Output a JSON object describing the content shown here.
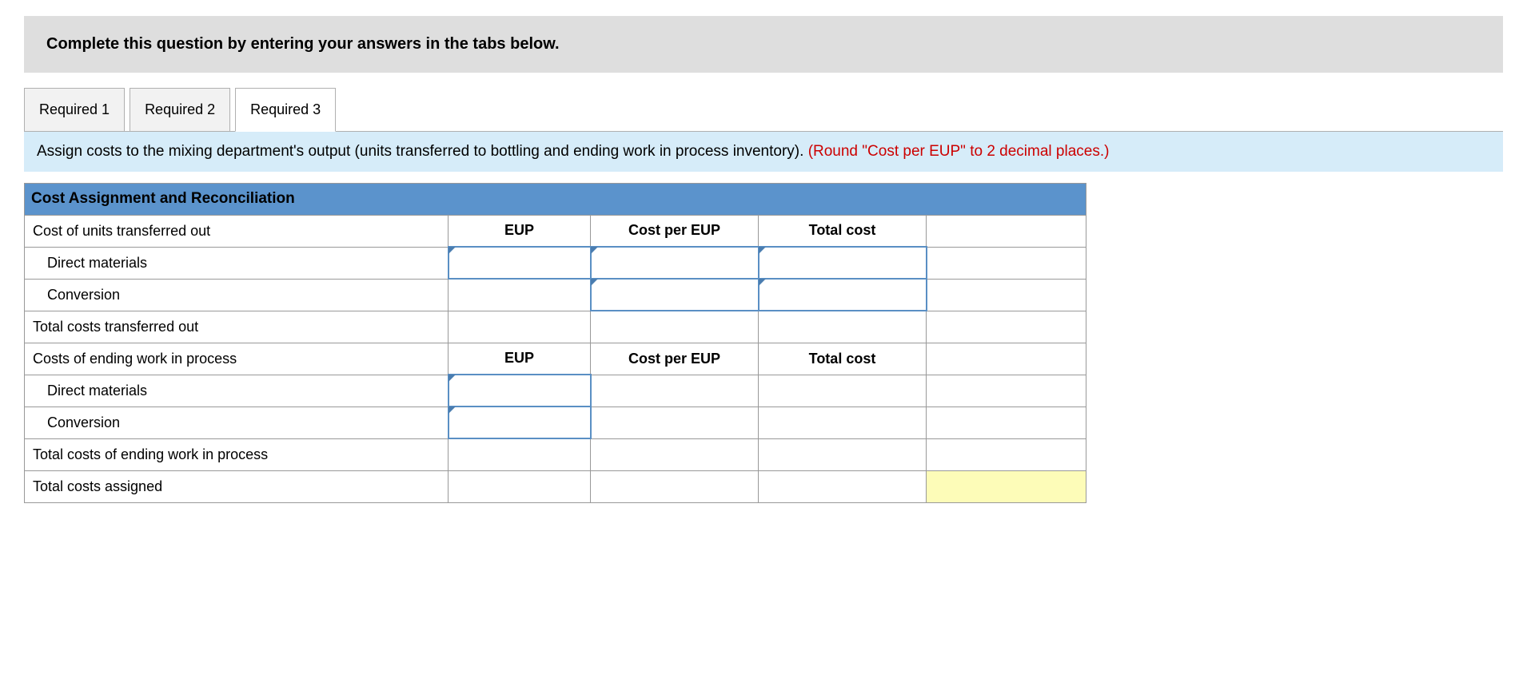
{
  "instruction": "Complete this question by entering your answers in the tabs below.",
  "tabs": {
    "t1": "Required 1",
    "t2": "Required 2",
    "t3": "Required 3"
  },
  "prompt": {
    "main": "Assign costs to the mixing department's output (units transferred to bottling and ending work in process inventory). ",
    "red": "(Round \"Cost per EUP\" to 2 decimal places.)"
  },
  "table": {
    "title": "Cost Assignment and Reconciliation",
    "section1": "Cost of units transferred out",
    "col_eup": "EUP",
    "col_cpe": "Cost per EUP",
    "col_total": "Total cost",
    "dm": "Direct materials",
    "conv": "Conversion",
    "tot1": "Total costs transferred out",
    "section2": "Costs of ending work in process",
    "tot2": "Total costs of ending work in process",
    "tot3": "Total costs assigned"
  }
}
